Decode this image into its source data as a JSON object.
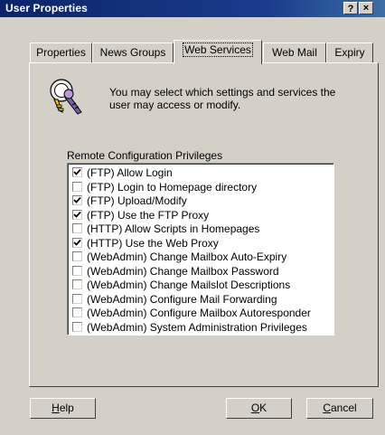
{
  "window": {
    "title": "User Properties",
    "help_label": "?",
    "close_label": "×"
  },
  "tabs": [
    {
      "label": "Properties",
      "active": false
    },
    {
      "label": "News Groups",
      "active": false
    },
    {
      "label": "Web Services",
      "active": true
    },
    {
      "label": "Web Mail",
      "active": false
    },
    {
      "label": "Expiry",
      "active": false
    }
  ],
  "intro": {
    "icon": "key-icon",
    "text": "You may select which settings and services the user may access or modify."
  },
  "privileges": {
    "label": "Remote Configuration Privileges",
    "items": [
      {
        "label": "(FTP) Allow Login",
        "checked": true
      },
      {
        "label": "(FTP) Login to Homepage directory",
        "checked": false
      },
      {
        "label": "(FTP) Upload/Modify",
        "checked": true
      },
      {
        "label": "(FTP) Use the FTP Proxy",
        "checked": true
      },
      {
        "label": "(HTTP) Allow Scripts in Homepages",
        "checked": false
      },
      {
        "label": "(HTTP) Use the Web Proxy",
        "checked": true
      },
      {
        "label": "(WebAdmin) Change Mailbox Auto-Expiry",
        "checked": false
      },
      {
        "label": "(WebAdmin) Change Mailbox Password",
        "checked": false
      },
      {
        "label": "(WebAdmin) Change Mailslot Descriptions",
        "checked": false
      },
      {
        "label": "(WebAdmin) Configure Mail Forwarding",
        "checked": false
      },
      {
        "label": "(WebAdmin) Configure Mailbox Autoresponder",
        "checked": false
      },
      {
        "label": "(WebAdmin) System Administration Privileges",
        "checked": false
      }
    ]
  },
  "buttons": {
    "help": {
      "mnemonic": "H",
      "rest": "elp"
    },
    "ok": {
      "mnemonic": "O",
      "rest": "K"
    },
    "cancel": {
      "mnemonic": "C",
      "rest": "ancel"
    }
  }
}
